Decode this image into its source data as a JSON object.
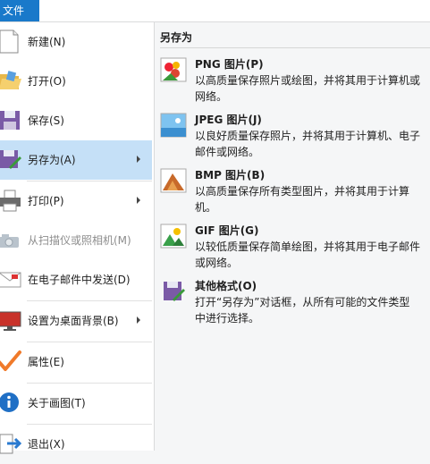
{
  "file_tab": "文件",
  "menu": [
    {
      "label": "新建(N)",
      "icon": "new-page-icon"
    },
    {
      "label": "打开(O)",
      "icon": "open-folder-icon"
    },
    {
      "label": "保存(S)",
      "icon": "save-disk-icon"
    },
    {
      "label": "另存为(A)",
      "icon": "save-as-icon",
      "selected": true,
      "submenu": true
    },
    {
      "label": "打印(P)",
      "icon": "printer-icon",
      "submenu": true
    },
    {
      "label": "从扫描仪或照相机(M)",
      "icon": "scanner-camera-icon",
      "disabled": true
    },
    {
      "label": "在电子邮件中发送(D)",
      "icon": "email-icon"
    },
    {
      "label": "设置为桌面背景(B)",
      "icon": "desktop-background-icon",
      "submenu": true
    },
    {
      "label": "属性(E)",
      "icon": "properties-check-icon"
    },
    {
      "label": "关于画图(T)",
      "icon": "info-icon"
    },
    {
      "label": "退出(X)",
      "icon": "exit-icon"
    }
  ],
  "panel": {
    "title": "另存为",
    "options": [
      {
        "title": "PNG 图片(P)",
        "desc": "以高质量保存照片或绘图，并将其用于计算机或网络。",
        "icon": "png-image-icon"
      },
      {
        "title": "JPEG 图片(J)",
        "desc": "以良好质量保存照片，并将其用于计算机、电子邮件或网络。",
        "icon": "jpeg-image-icon"
      },
      {
        "title": "BMP 图片(B)",
        "desc": "以高质量保存所有类型图片，并将其用于计算机。",
        "icon": "bmp-image-icon"
      },
      {
        "title": "GIF 图片(G)",
        "desc": "以较低质量保存简单绘图，并将其用于电子邮件或网络。",
        "icon": "gif-image-icon"
      },
      {
        "title": "其他格式(O)",
        "desc": "打开“另存为”对话框，从所有可能的文件类型中进行选择。",
        "icon": "other-formats-icon"
      }
    ]
  }
}
